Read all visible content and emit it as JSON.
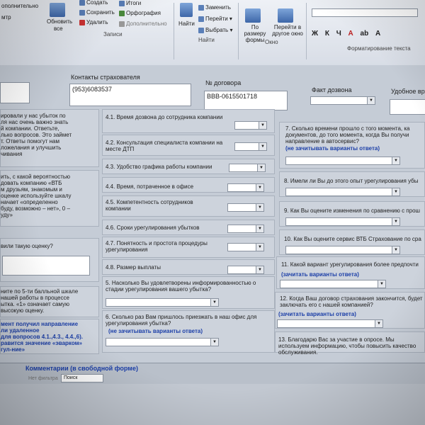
{
  "ribbon": {
    "menu_top_left": "ополнительно",
    "menu_left_2": "мтр",
    "refresh_label": "Обновить",
    "refresh_sub": "все",
    "create_label": "Создать",
    "save_label": "Сохранить",
    "delete_label": "Удалить",
    "totals_label": "Итоги",
    "spelling_label": "Орфография",
    "more_label": "Дополнительно",
    "records_group": "Записи",
    "find_label": "Найти",
    "replace_label": "Заменить",
    "goto_label": "Перейти",
    "select_label": "Выбрать",
    "find_group": "Найти",
    "formsize_label": "По размеру формы",
    "goto_other_label": "Перейти в другое окно",
    "window_group": "Окно",
    "text_format_group": "Форматирование текста",
    "format_buttons": [
      "Ж",
      "К",
      "Ч",
      "А",
      "ab",
      "A"
    ]
  },
  "form": {
    "contacts_label": "Контакты страхователя",
    "phone_value": "(953)6083537",
    "contract_label": "№ договора",
    "contract_value": "ВВВ-0615501718",
    "fact_label": "Факт дозвона",
    "convenient_label": "Удобное вр",
    "left_intro": "ировали у нас убыток по\nля нас очень важно знать\nй компании. Ответьте,\nлько вопросов. Это займет\nт. Ответы помогут нам\nложелания и улучшить\nчивания",
    "left_q2": "ить, с какой вероятностью\nдовать компанию «ВТБ\nм друзьям, знакомым и\nоценке используйте шкалу\nначает «определенно\nбуду, возможно – нет», 0 –\nуду»",
    "left_q3": "вили такую оценку?",
    "left_q4": "ните по 5-ти балльной шкале\nнашей работы в процессе\nытка. «1» означает самую\nвысокую оценку.",
    "left_note": "мент получил направление\nли удаленное\nдля вопросов 4.1.,4.3., 4.4.,6).\nравится значение «эварком»\nгул-ние»",
    "q41": "4.1. Время дозвона до сотрудника компании",
    "q42": "4.2. Консультация специалиста компании на месте ДТП",
    "q43": "4.3. Удобство графика работы компании",
    "q44": "4.4. Время, потраченное в офисе",
    "q45": "4.5. Компетентность сотрудников компании",
    "q46": "4.6. Сроки урегулирования убытков",
    "q47": "4.7. Понятность и простота процедуры урегулирования",
    "q48": "4.8. Размер выплаты",
    "q5": "5. Насколько Вы удовлетворены информированностью о стадии урегулирования вашего убытка?",
    "q6": "6. Сколько раз Вам пришлось приезжать в наш офис для урегулирования убытка?",
    "q6_link": "(не зачитывать варианты ответа)",
    "q7": "7. Сколько времени прошло с того момента, ка документов, до того момента, когда Вы получи направление в автосервис?",
    "q7_link": "(не зачитывать варианты ответа)",
    "q8": "8. Имели ли Вы до этого опыт урегулирования убы",
    "q9": "9. Как Вы оцените изменения по сравнению с прош",
    "q10": "10. Как Вы оцените сервис ВТБ Страхование по сра",
    "q11": "11. Какой вариант урегулирования более предпочти",
    "q11_link": "(зачитать варианты ответа)",
    "q12": "12. Когда Ваш договор страхования закончится, будет заключать его с нашей компанией?",
    "q12_link": "(зачитать варианты ответа)",
    "q13": "13. Благодарю Вас за участие в опросе. Мы используем информацию, чтобы повысить качество обслуживания.",
    "comments": "Комментарии (в свободной форме)"
  },
  "status": {
    "search_label": "Поиск",
    "filter_label": "Нет фильтра"
  },
  "colors": {
    "link": "#1c3fa8",
    "background": "#c5ccd6",
    "ribbon": "#dfe3ea"
  }
}
